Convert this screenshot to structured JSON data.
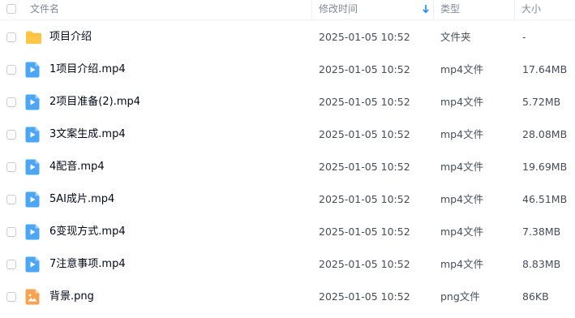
{
  "header": {
    "name_label": "文件名",
    "mtime_label": "修改时间",
    "sort_icon": "arrow-down-icon",
    "type_label": "类型",
    "size_label": "大小"
  },
  "colors": {
    "folder": "#fdc646",
    "video": "#4ba6f5",
    "image": "#f7a24f",
    "sort_arrow": "#1c8bf5"
  },
  "files": [
    {
      "name": "项目介绍",
      "mtime": "2025-01-05 10:52",
      "type": "文件夹",
      "size": "-",
      "icon": "folder-icon"
    },
    {
      "name": "1项目介绍.mp4",
      "mtime": "2025-01-05 10:52",
      "type": "mp4文件",
      "size": "17.64MB",
      "icon": "video-file-icon"
    },
    {
      "name": "2项目准备(2).mp4",
      "mtime": "2025-01-05 10:52",
      "type": "mp4文件",
      "size": "5.72MB",
      "icon": "video-file-icon"
    },
    {
      "name": "3文案生成.mp4",
      "mtime": "2025-01-05 10:52",
      "type": "mp4文件",
      "size": "28.08MB",
      "icon": "video-file-icon"
    },
    {
      "name": "4配音.mp4",
      "mtime": "2025-01-05 10:52",
      "type": "mp4文件",
      "size": "19.69MB",
      "icon": "video-file-icon"
    },
    {
      "name": "5AI成片.mp4",
      "mtime": "2025-01-05 10:52",
      "type": "mp4文件",
      "size": "46.51MB",
      "icon": "video-file-icon"
    },
    {
      "name": "6变现方式.mp4",
      "mtime": "2025-01-05 10:52",
      "type": "mp4文件",
      "size": "7.38MB",
      "icon": "video-file-icon"
    },
    {
      "name": "7注意事项.mp4",
      "mtime": "2025-01-05 10:52",
      "type": "mp4文件",
      "size": "8.83MB",
      "icon": "video-file-icon"
    },
    {
      "name": "背景.png",
      "mtime": "2025-01-05 10:52",
      "type": "png文件",
      "size": "86KB",
      "icon": "image-file-icon"
    }
  ]
}
